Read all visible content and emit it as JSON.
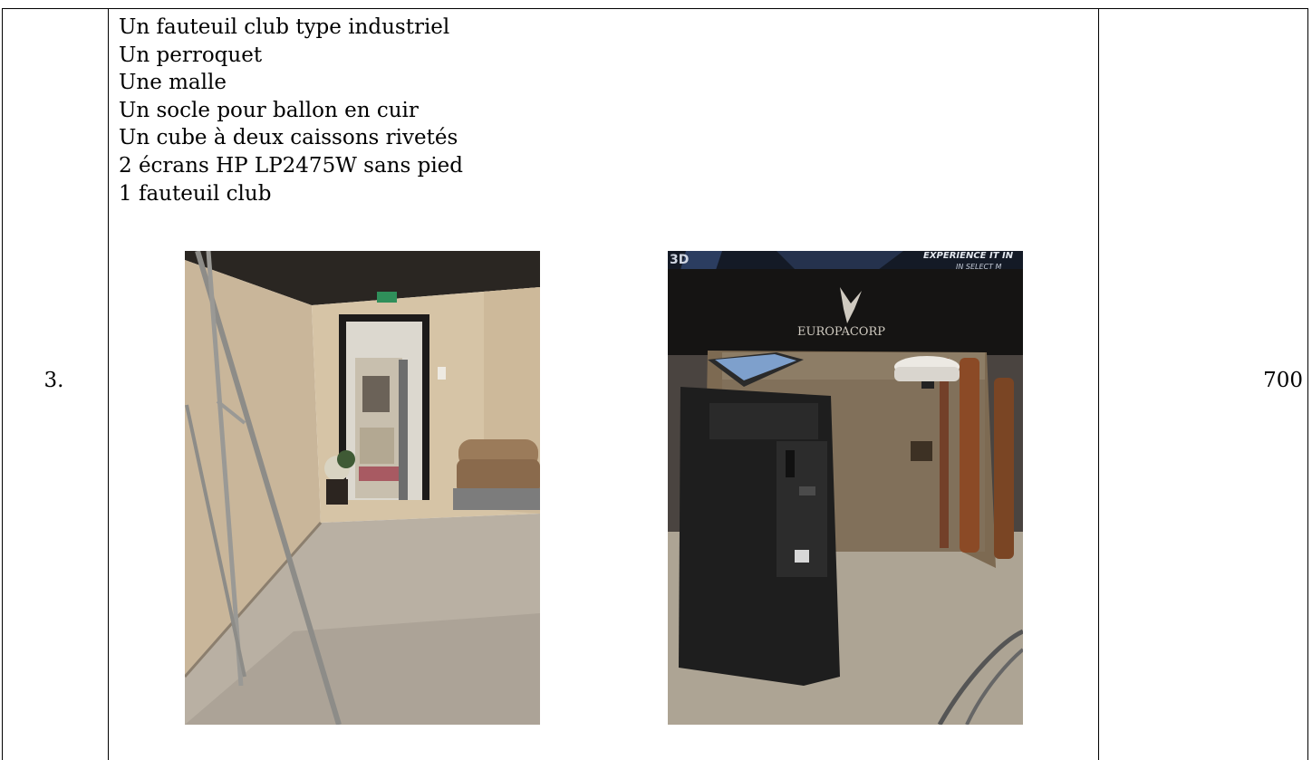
{
  "row": {
    "number": "3.",
    "items": [
      "Un fauteuil club type industriel",
      "Un perroquet",
      "Une malle",
      "Un socle pour ballon en cuir",
      "Un cube à deux caissons rivetés",
      "2 écrans HP LP2475W sans pied",
      "1 fauteuil club"
    ],
    "price": "700"
  },
  "photo_right": {
    "poster_text_top": "EXPERIENCE IT IN",
    "poster_text_sub": "IN SELECT M",
    "poster_badge": "3D",
    "logo_text": "EUROPACORP"
  }
}
